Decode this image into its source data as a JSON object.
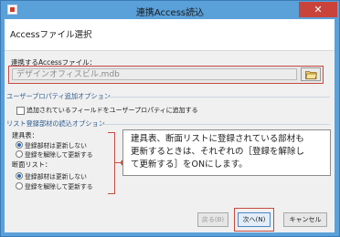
{
  "window": {
    "title": "連携Access読込",
    "close_glyph": "✕"
  },
  "dialog": {
    "heading": "Accessファイル選択",
    "file_label": "連携するAccessファイル：",
    "file_value": "デザインオフィスビル.mdb"
  },
  "user_property": {
    "section_title": "ユーザープロパティ追加オプション",
    "checkbox_label": "追加されているフィールドをユーザープロパティに追加する",
    "checked": false
  },
  "list_options": {
    "section_title": "リスト登録部材の読込オプション",
    "groups": [
      {
        "title": "建具表：",
        "options": [
          {
            "label": "登録部材は更新しない",
            "selected": true
          },
          {
            "label": "登録を解除して更新する",
            "selected": false
          }
        ]
      },
      {
        "title": "断面リスト：",
        "options": [
          {
            "label": "登録部材は更新しない",
            "selected": true
          },
          {
            "label": "登録を解除して更新する",
            "selected": false
          }
        ]
      }
    ]
  },
  "callout": {
    "lines": [
      "建具表、断面リストに登録されている部材も",
      "更新するときは、それぞれの［登録を解除し",
      "て更新する］をONにします。"
    ]
  },
  "buttons": {
    "back": "戻る(B)",
    "next": "次へ(N)",
    "cancel": "キャンセル"
  },
  "colors": {
    "titlebar": "#5aa0d9",
    "close": "#c9433b",
    "highlight": "#c74a3f",
    "section_text": "#2a5a8e"
  }
}
